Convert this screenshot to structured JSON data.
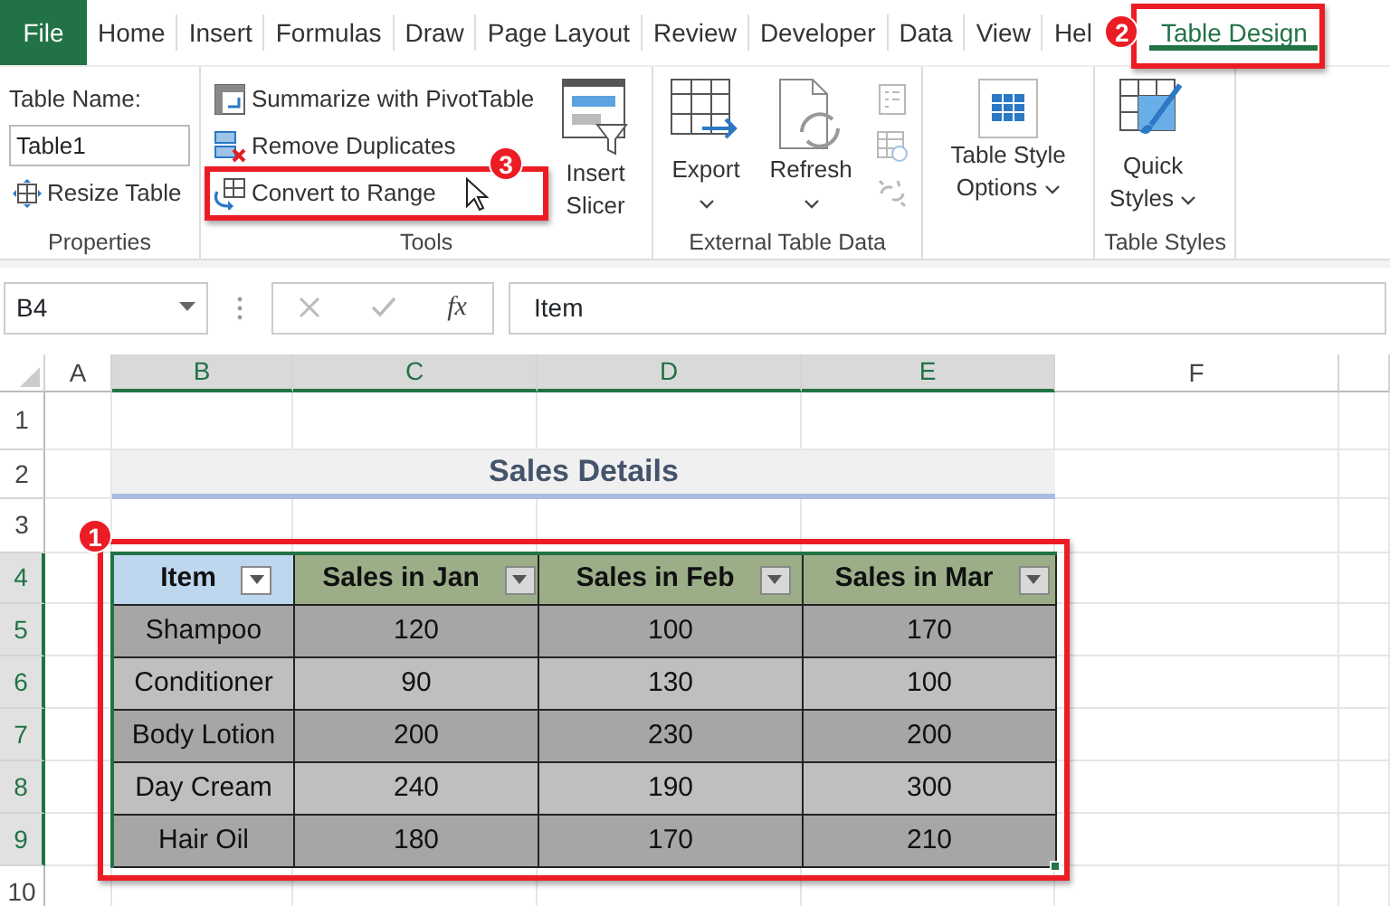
{
  "tabs": [
    {
      "label": "File",
      "kind": "file",
      "selected": false
    },
    {
      "label": "Home",
      "kind": "tab",
      "selected": false
    },
    {
      "label": "Insert",
      "kind": "tab",
      "selected": false
    },
    {
      "label": "Formulas",
      "kind": "tab",
      "selected": false
    },
    {
      "label": "Draw",
      "kind": "tab",
      "selected": false
    },
    {
      "label": "Page Layout",
      "kind": "tab",
      "selected": false
    },
    {
      "label": "Review",
      "kind": "tab",
      "selected": false
    },
    {
      "label": "Developer",
      "kind": "tab",
      "selected": false
    },
    {
      "label": "Data",
      "kind": "tab",
      "selected": false
    },
    {
      "label": "View",
      "kind": "tab",
      "selected": false
    },
    {
      "label": "Hel",
      "kind": "tab",
      "selected": false
    },
    {
      "label": "Table Design",
      "kind": "tab",
      "selected": true,
      "callout": "2"
    }
  ],
  "ribbon": {
    "groups": [
      {
        "label": "Properties",
        "controls": [
          {
            "kind": "caption",
            "label": "Table Name:"
          },
          {
            "kind": "field",
            "value": "Table1"
          },
          {
            "kind": "small",
            "label": "Resize Table",
            "disabled": false
          }
        ]
      },
      {
        "label": "Tools",
        "controls": [
          {
            "kind": "small",
            "label": "Summarize with PivotTable",
            "disabled": false
          },
          {
            "kind": "small",
            "label": "Remove Duplicates",
            "disabled": false
          },
          {
            "kind": "small",
            "label": "Convert to Range",
            "disabled": false,
            "callout": "3"
          },
          {
            "kind": "large",
            "label": "Insert Slicer",
            "disabled": false
          }
        ]
      },
      {
        "label": "External Table Data",
        "controls": [
          {
            "kind": "large-menu",
            "label": "Export",
            "disabled": false
          },
          {
            "kind": "large-menu",
            "label": "Refresh",
            "disabled": false
          },
          {
            "kind": "icon",
            "disabled": true
          },
          {
            "kind": "icon",
            "disabled": true
          },
          {
            "kind": "icon",
            "disabled": true
          }
        ]
      },
      {
        "controls": [
          {
            "kind": "large-menu",
            "label": "Table Style Options",
            "disabled": false
          }
        ]
      },
      {
        "label": "Table Styles",
        "controls": [
          {
            "kind": "large-menu",
            "label": "Quick Styles",
            "disabled": false
          }
        ]
      }
    ]
  },
  "formula_bar": {
    "name_box": "B4",
    "fx_label": "fx",
    "value": "Item"
  },
  "sheet": {
    "columns": [
      {
        "label": "A",
        "selected": false
      },
      {
        "label": "B",
        "selected": true
      },
      {
        "label": "C",
        "selected": true
      },
      {
        "label": "D",
        "selected": true
      },
      {
        "label": "E",
        "selected": true
      },
      {
        "label": "F",
        "selected": false
      }
    ],
    "rows": [
      {
        "label": "1",
        "selected": false
      },
      {
        "label": "2",
        "selected": false
      },
      {
        "label": "3",
        "selected": false
      },
      {
        "label": "4",
        "selected": true
      },
      {
        "label": "5",
        "selected": true
      },
      {
        "label": "6",
        "selected": true
      },
      {
        "label": "7",
        "selected": true
      },
      {
        "label": "8",
        "selected": true
      },
      {
        "label": "9",
        "selected": true
      },
      {
        "label": "10",
        "selected": false
      }
    ],
    "title": "Sales Details",
    "table": {
      "callout": "1",
      "headers": [
        {
          "label": "Item",
          "selected": true
        },
        {
          "label": "Sales in Jan",
          "selected": false
        },
        {
          "label": "Sales in Feb",
          "selected": false
        },
        {
          "label": "Sales in Mar",
          "selected": false
        }
      ],
      "rows": [
        [
          "Shampoo",
          "120",
          "100",
          "170"
        ],
        [
          "Conditioner",
          "90",
          "130",
          "100"
        ],
        [
          "Body Lotion",
          "200",
          "230",
          "200"
        ],
        [
          "Day Cream",
          "240",
          "190",
          "300"
        ],
        [
          "Hair Oil",
          "180",
          "170",
          "210"
        ]
      ]
    }
  }
}
